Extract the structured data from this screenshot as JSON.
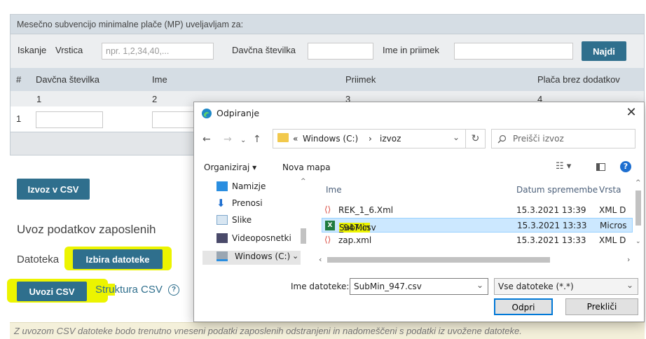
{
  "page": {
    "panel_heading": "Mesečno subvencijo minimalne plače (MP) uveljavljam za:",
    "search": {
      "iskanje_label": "Iskanje",
      "vrstica_label": "Vrstica",
      "vrstica_placeholder": "npr. 1,2,34,40,...",
      "davcna_label": "Davčna številka",
      "ime_label": "Ime in priimek",
      "najdi_button": "Najdi"
    },
    "table": {
      "headers": [
        "#",
        "Davčna številka",
        "Ime",
        "Priimek",
        "Plača brez dodatkov"
      ],
      "numbers": [
        "1",
        "2",
        "3",
        "4"
      ],
      "row_index": "1"
    },
    "izvoz_button": "Izvoz v CSV",
    "uvoz_section_title": "Uvoz podatkov zaposlenih",
    "datoteka_label": "Datoteka",
    "izbira_button": "Izbira datoteke",
    "uvozi_button": "Uvozi CSV",
    "struktura_link_a": "Stru",
    "struktura_link_b": "ktura CSV",
    "help_icon": "?",
    "footer_note": "Z uvozom CSV datoteke bodo trenutno vneseni podatki zaposlenih odstranjeni in nadomeščeni s podatki iz uvožene datoteke."
  },
  "dialog": {
    "title": "Odpiranje",
    "close": "✕",
    "address": {
      "prefix": "«",
      "part1": "Windows (C:)",
      "sep": "›",
      "part2": "izvoz"
    },
    "search_placeholder": "Preišči izvoz",
    "toolbar": {
      "organize": "Organiziraj ▾",
      "new_folder": "Nova mapa"
    },
    "nav_items": [
      "Namizje",
      "Prenosi",
      "Slike",
      "Videoposnetki",
      "Windows (C:)"
    ],
    "columns": {
      "name": "Ime",
      "date": "Datum spremembe",
      "type": "Vrsta"
    },
    "files": [
      {
        "name": "REK_1_6.Xml",
        "date": "15.3.2021 13:39",
        "type": "XML D"
      },
      {
        "name_hl": "SubMin",
        "name_rest": "_947.csv",
        "date": "15.3.2021 13:33",
        "type": "Micros"
      },
      {
        "name": "zap.xml",
        "date": "15.3.2021 13:33",
        "type": "XML D"
      }
    ],
    "filename_label": "Ime datoteke:",
    "filename_value": "SubMin_947.csv",
    "filter_value": "Vse datoteke (*.*)",
    "open_button": "Odpri",
    "cancel_button": "Prekliči"
  },
  "colors": {
    "accent": "#2f6f8d",
    "highlight": "#ecf400",
    "selection": "#cce8ff"
  }
}
